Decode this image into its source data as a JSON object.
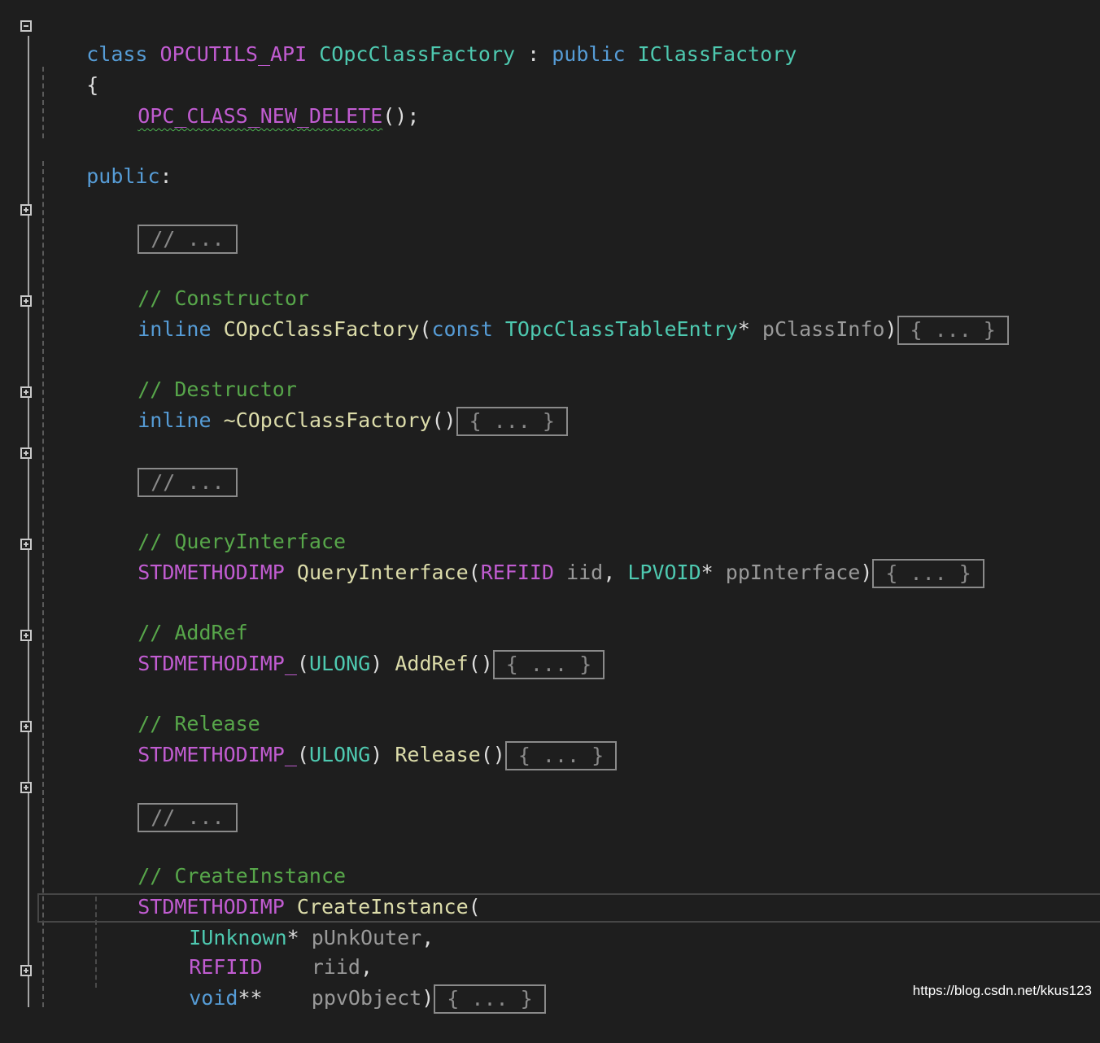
{
  "code": {
    "class_kw": "class",
    "api_macro": "OPCUTILS_API",
    "class_name": "COpcClassFactory",
    "colon": " : ",
    "public_kw": "public",
    "base_class": "IClassFactory",
    "open_brace": "{",
    "new_delete_macro": "OPC_CLASS_NEW_DELETE",
    "call_suffix": "();",
    "public_label": "public",
    "label_colon": ":",
    "collapsed_comment": "// ...",
    "collapsed_body": "{ ... }",
    "comment_constructor": "// Constructor",
    "inline_kw": "inline",
    "ctor_name": "COpcClassFactory",
    "open_paren": "(",
    "const_kw": "const",
    "table_entry_type": "TOpcClassTableEntry",
    "star": "*",
    "param_classinfo": "pClassInfo",
    "close_paren": ")",
    "comment_destructor": "// Destructor",
    "dtor_name": "~COpcClassFactory",
    "empty_parens": "()",
    "comment_query": "// QueryInterface",
    "stdmethodimp": "STDMETHODIMP",
    "query_name": "QueryInterface",
    "refiid": "REFIID",
    "param_iid": "iid",
    "comma": ",",
    "lpvoid": "LPVOID",
    "param_ppinterface": "ppInterface",
    "comment_addref": "// AddRef",
    "stdmethodimp_": "STDMETHODIMP_",
    "ulong": "ULONG",
    "addref_name": "AddRef",
    "comment_release": "// Release",
    "release_name": "Release",
    "comment_create": "// CreateInstance",
    "create_name": "CreateInstance",
    "iunknown": "IUnknown",
    "param_punkouter": "pUnkOuter",
    "param_riid": "riid",
    "void_kw": "void",
    "double_star": "**",
    "param_ppvobject": "ppvObject"
  },
  "watermark": "https://blog.csdn.net/kkus123"
}
